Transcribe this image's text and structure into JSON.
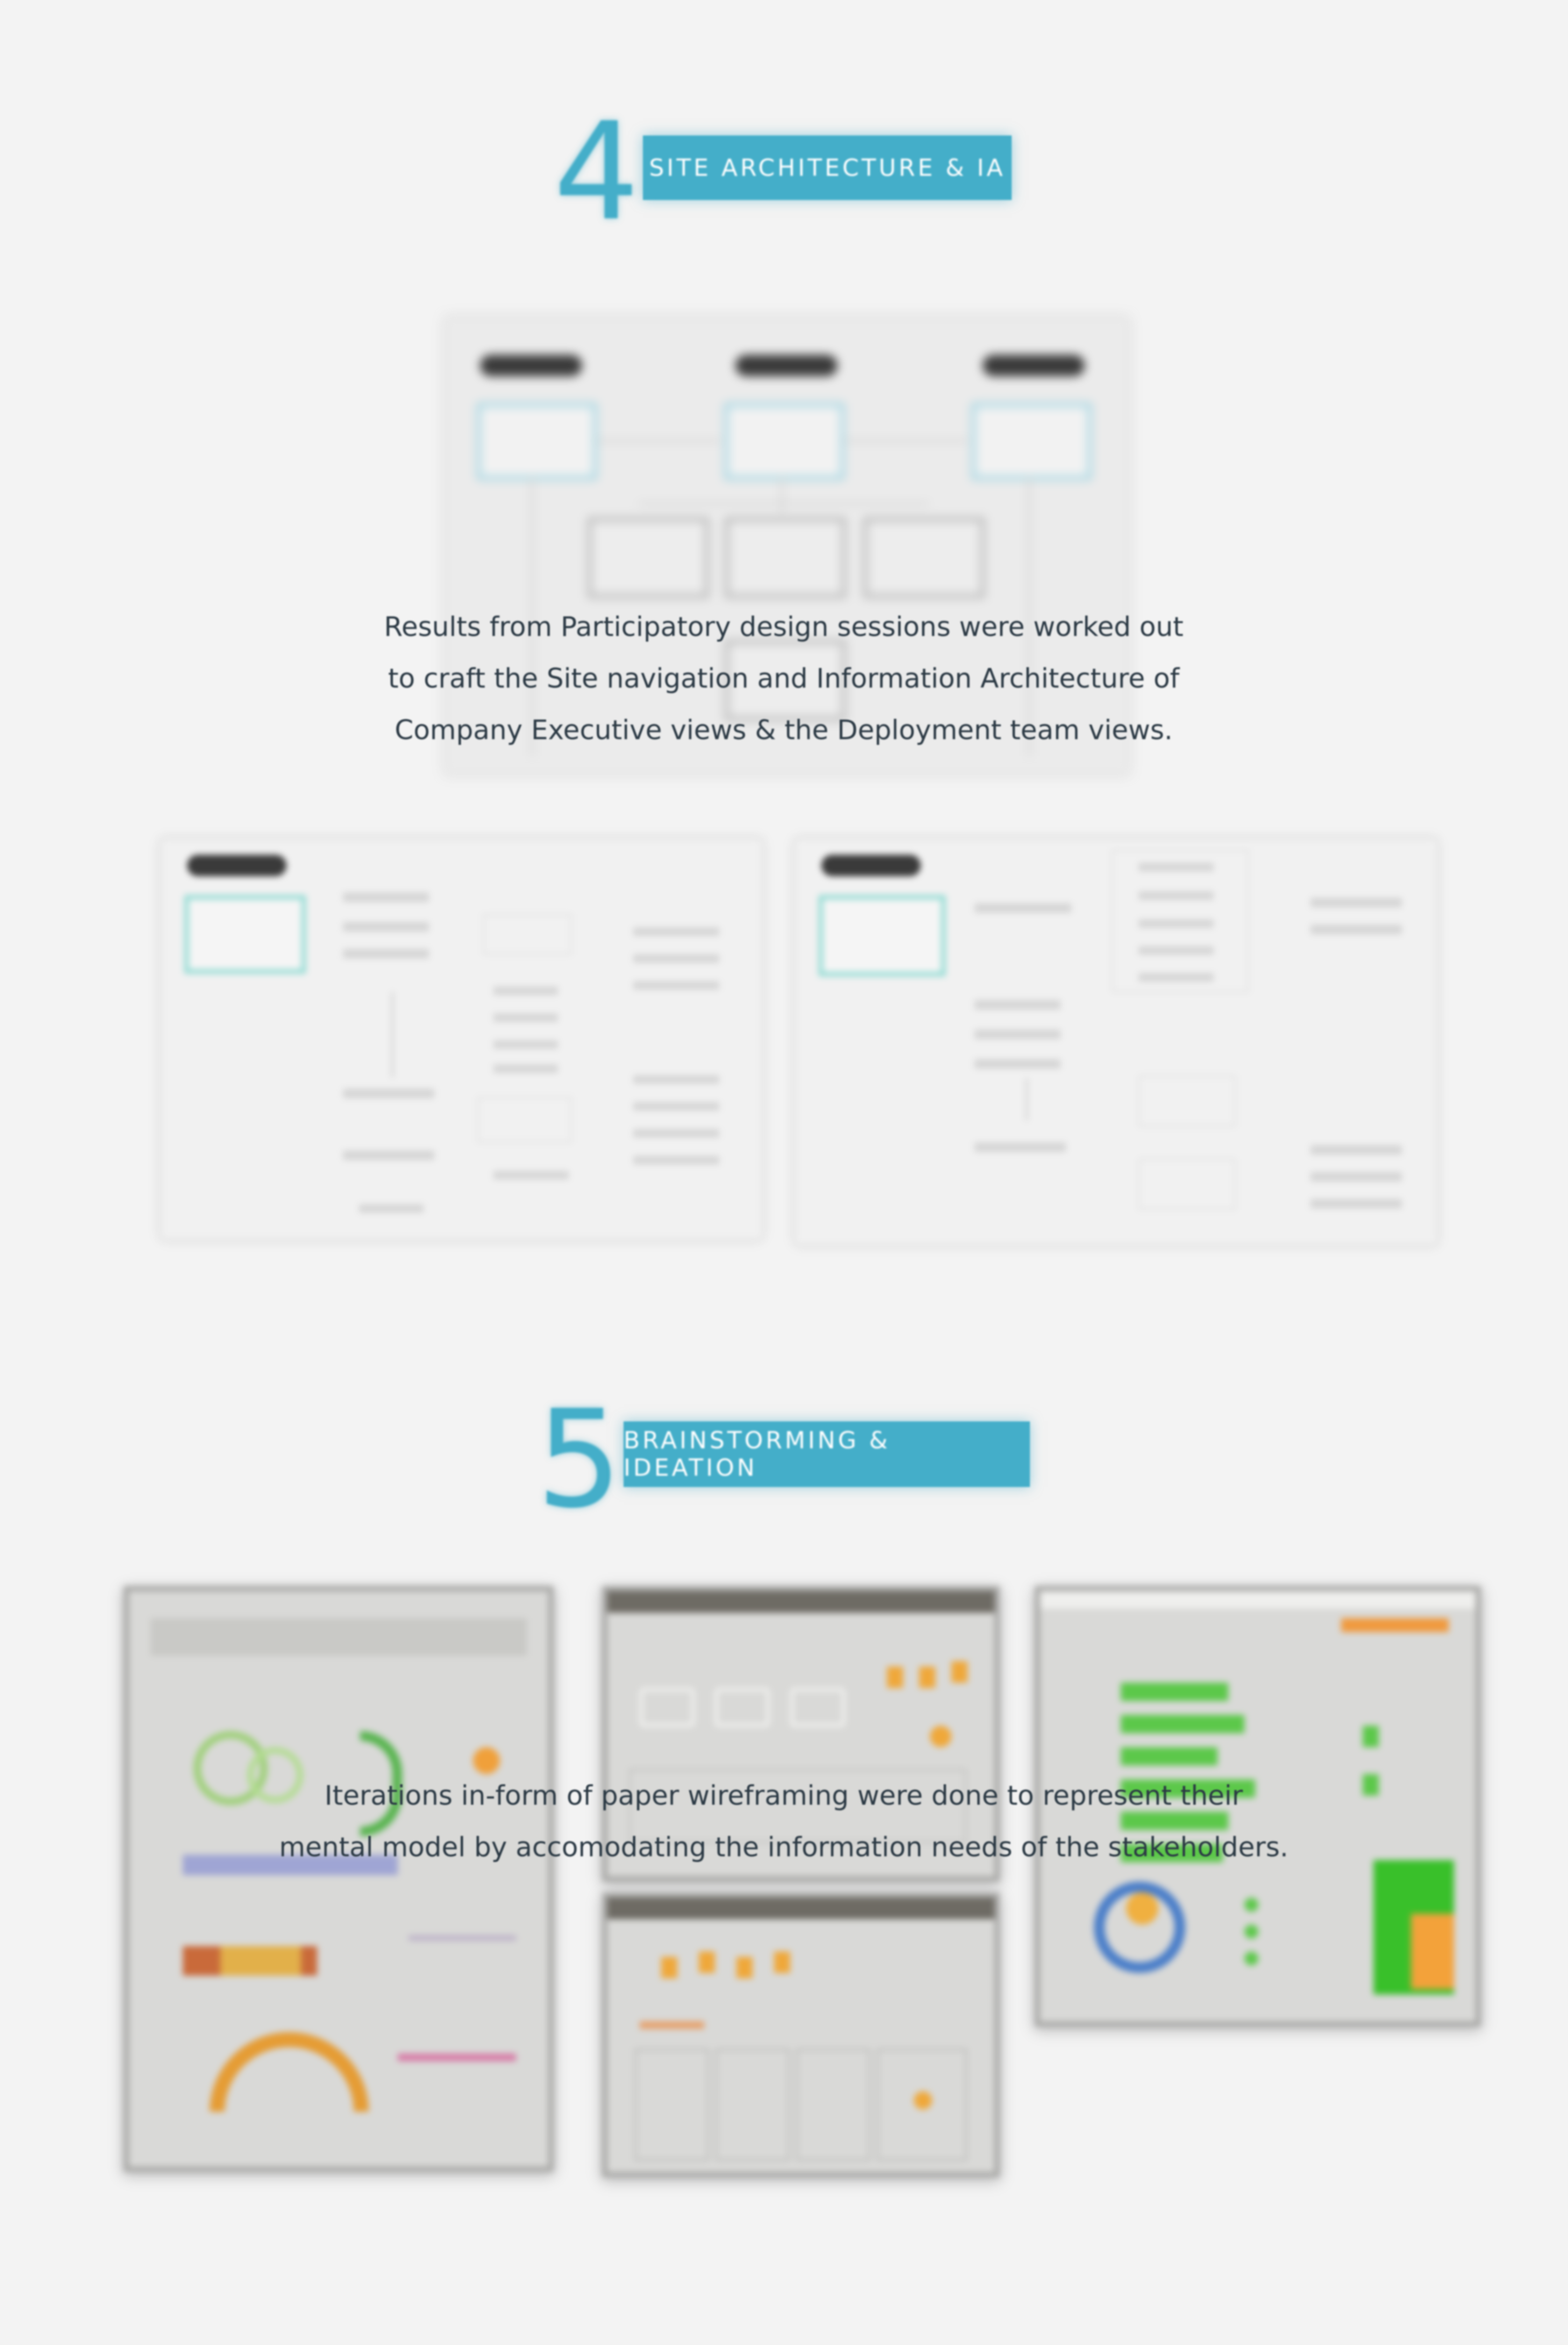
{
  "sections": [
    {
      "number": "4",
      "title": "SITE ARCHITECTURE & IA",
      "caption": [
        "Results from Participatory design sessions were worked out",
        "to craft the Site navigation and Information Architecture of",
        "Company Executive views & the Deployment team views."
      ]
    },
    {
      "number": "5",
      "title": "BRAINSTORMING & IDEATION",
      "caption": [
        "Iterations in-form of paper wireframing were done to represent their",
        "mental model by accomodating the information needs of the stakeholders."
      ]
    }
  ],
  "colors": {
    "accent": "#44aec9",
    "background": "#f3f3f3",
    "text": "#2c3a45"
  }
}
